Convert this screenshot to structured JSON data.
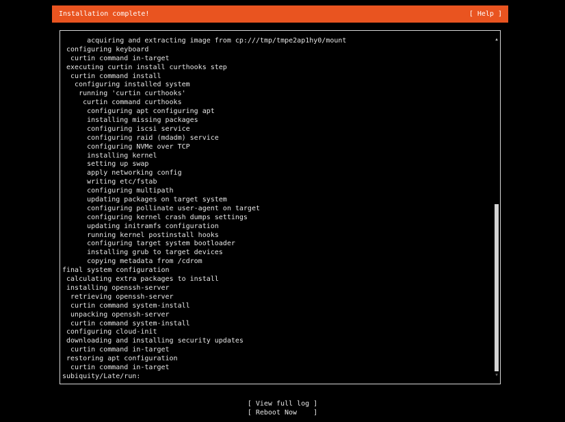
{
  "header": {
    "title": "Installation complete!",
    "help_label": "[ Help ]",
    "accent_color": "#e95420"
  },
  "log": {
    "lines": [
      "      acquiring and extracting image from cp:///tmp/tmpe2ap1hy0/mount",
      " configuring keyboard",
      "  curtin command in-target",
      " executing curtin install curthooks step",
      "  curtin command install",
      "   configuring installed system",
      "    running 'curtin curthooks'",
      "     curtin command curthooks",
      "      configuring apt configuring apt",
      "      installing missing packages",
      "      configuring iscsi service",
      "      configuring raid (mdadm) service",
      "      configuring NVMe over TCP",
      "      installing kernel",
      "      setting up swap",
      "      apply networking config",
      "      writing etc/fstab",
      "      configuring multipath",
      "      updating packages on target system",
      "      configuring pollinate user-agent on target",
      "      configuring kernel crash dumps settings",
      "      updating initramfs configuration",
      "      running kernel postinstall hooks",
      "      configuring target system bootloader",
      "      installing grub to target devices",
      "      copying metadata from /cdrom",
      "final system configuration",
      " calculating extra packages to install",
      " installing openssh-server",
      "  retrieving openssh-server",
      "  curtin command system-install",
      "  unpacking openssh-server",
      "  curtin command system-install",
      " configuring cloud-init",
      " downloading and installing security updates",
      "  curtin command in-target",
      " restoring apt configuration",
      "  curtin command in-target",
      "subiquity/Late/run:"
    ],
    "scroll_up_icon": "▲",
    "scroll_down_icon": "▼"
  },
  "actions": {
    "view_log_label": "[ View full log ]",
    "reboot_label": "[ Reboot Now    ]"
  }
}
